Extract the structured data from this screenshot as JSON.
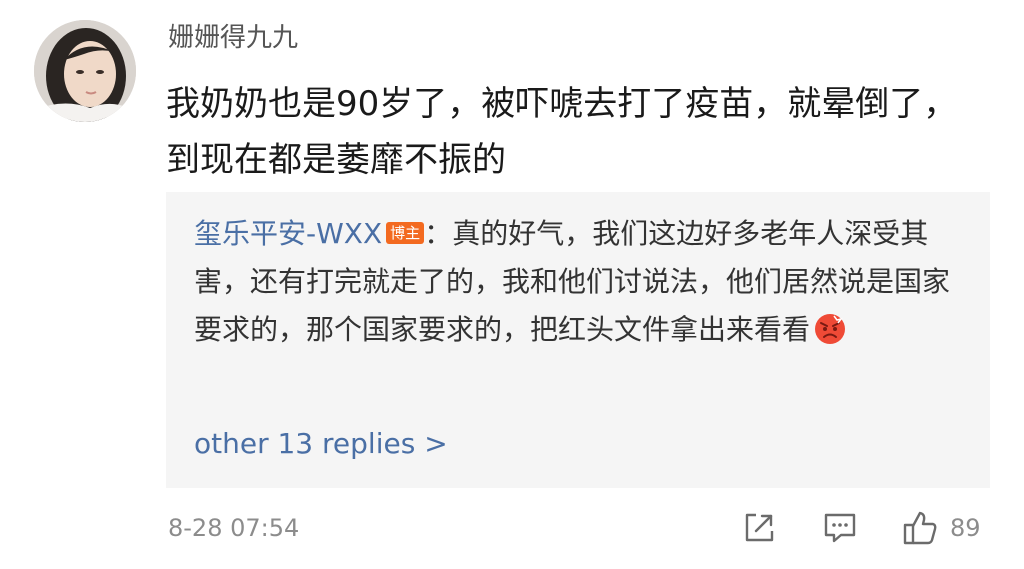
{
  "comment": {
    "username": "姗姗得九九",
    "text": "我奶奶也是90岁了，被吓唬去打了疫苗，就晕倒了，到现在都是萎靡不振的",
    "avatar_icon": "avatar-photo"
  },
  "reply": {
    "author": "玺乐平安-WXX",
    "badge": "博主",
    "separator": "：",
    "text": "真的好气，我们这边好多老年人深受其害，还有打完就走了的，我和他们讨说法，他们居然说是国家要求的，那个国家要求的，把红头文件拿出来看看",
    "emoji_icon": "angry-face-emoji",
    "more_replies": "other 13 replies >"
  },
  "footer": {
    "timestamp": "8-28 07:54",
    "share_icon": "share-icon",
    "comment_icon": "comment-icon",
    "like_icon": "thumbs-up-icon",
    "like_count": "89"
  },
  "colors": {
    "link": "#4a6fa5",
    "badge": "#f36a20",
    "reply_background": "#f5f5f5",
    "muted": "#8c8c8c"
  }
}
